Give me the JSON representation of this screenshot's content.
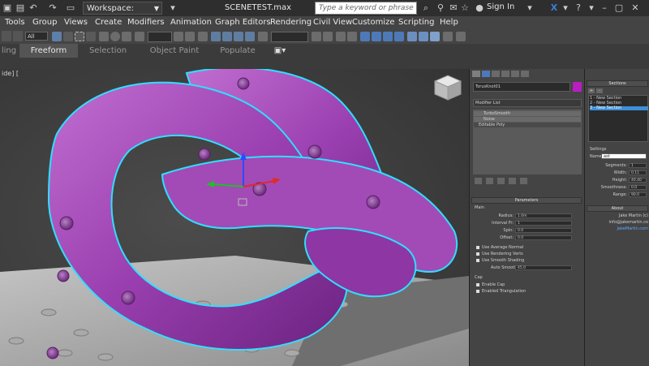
{
  "title_bar": {
    "workspace_label": "Workspace: Default",
    "document_title": "SCENETEST.max",
    "search_placeholder": "Type a keyword or phrase",
    "sign_in": "Sign In"
  },
  "menubar": {
    "items": [
      "Tools",
      "Group",
      "Views",
      "Create",
      "Modifiers",
      "Animation",
      "Graph Editors",
      "Rendering",
      "Civil View",
      "Customize",
      "Scripting",
      "Help"
    ]
  },
  "toolbar": {
    "selection_filter": "All"
  },
  "ribbon": {
    "tabs": [
      "ling",
      "Freeform",
      "Selection",
      "Object Paint",
      "Populate"
    ],
    "active_tab": "Freeform"
  },
  "viewport": {
    "label": "ide] ["
  },
  "command_panel": {
    "object_name": "TorusKnot01",
    "object_color": "#b81ec0",
    "modifier_list_label": "Modifier List",
    "stack": [
      "TurboSmooth",
      "Noise",
      "Editable Poly"
    ],
    "parameters_header": "Parameters",
    "main_label": "Main",
    "params": [
      {
        "label": "Radius:",
        "value": "1.0m"
      },
      {
        "label": "Interval Fr:",
        "value": "1"
      },
      {
        "label": "Spin:",
        "value": "0.0"
      },
      {
        "label": "Offset:",
        "value": "0.0"
      }
    ],
    "checks": [
      "Use Average Normal",
      "Use Rendering Verts",
      "Use Smooth Shading"
    ],
    "auto_smooth_label": "Auto Smooth",
    "auto_smooth_value": "45.0",
    "cap_label": "Cap",
    "cap_checks": [
      "Enable Cap",
      "Enabled Triangulation"
    ]
  },
  "right_panel": {
    "sections_header": "Sections",
    "sections": [
      "1 - New Section",
      "2 - New Section",
      "3 - New Section"
    ],
    "settings_label": "Settings",
    "name_label": "Name:",
    "name_value": "ast",
    "settings_rows": [
      {
        "label": "Segments:",
        "value": "1"
      },
      {
        "label": "Width:",
        "value": "0.11"
      },
      {
        "label": "Height:",
        "value": "40.40"
      },
      {
        "label": "Smoothness:",
        "value": "0.0"
      },
      {
        "label": "Range:",
        "value": "90.0"
      }
    ],
    "about_header": "About",
    "about_lines": [
      "Jake Martin (c)",
      "info@jakemartin.co",
      "JakeMartin.com"
    ]
  },
  "colors": {
    "knot_purple": "#9a3fb0",
    "knot_highlight": "#c06ed0",
    "selection_outline": "#2ee0ff",
    "active_section": "#3d8fd6"
  }
}
